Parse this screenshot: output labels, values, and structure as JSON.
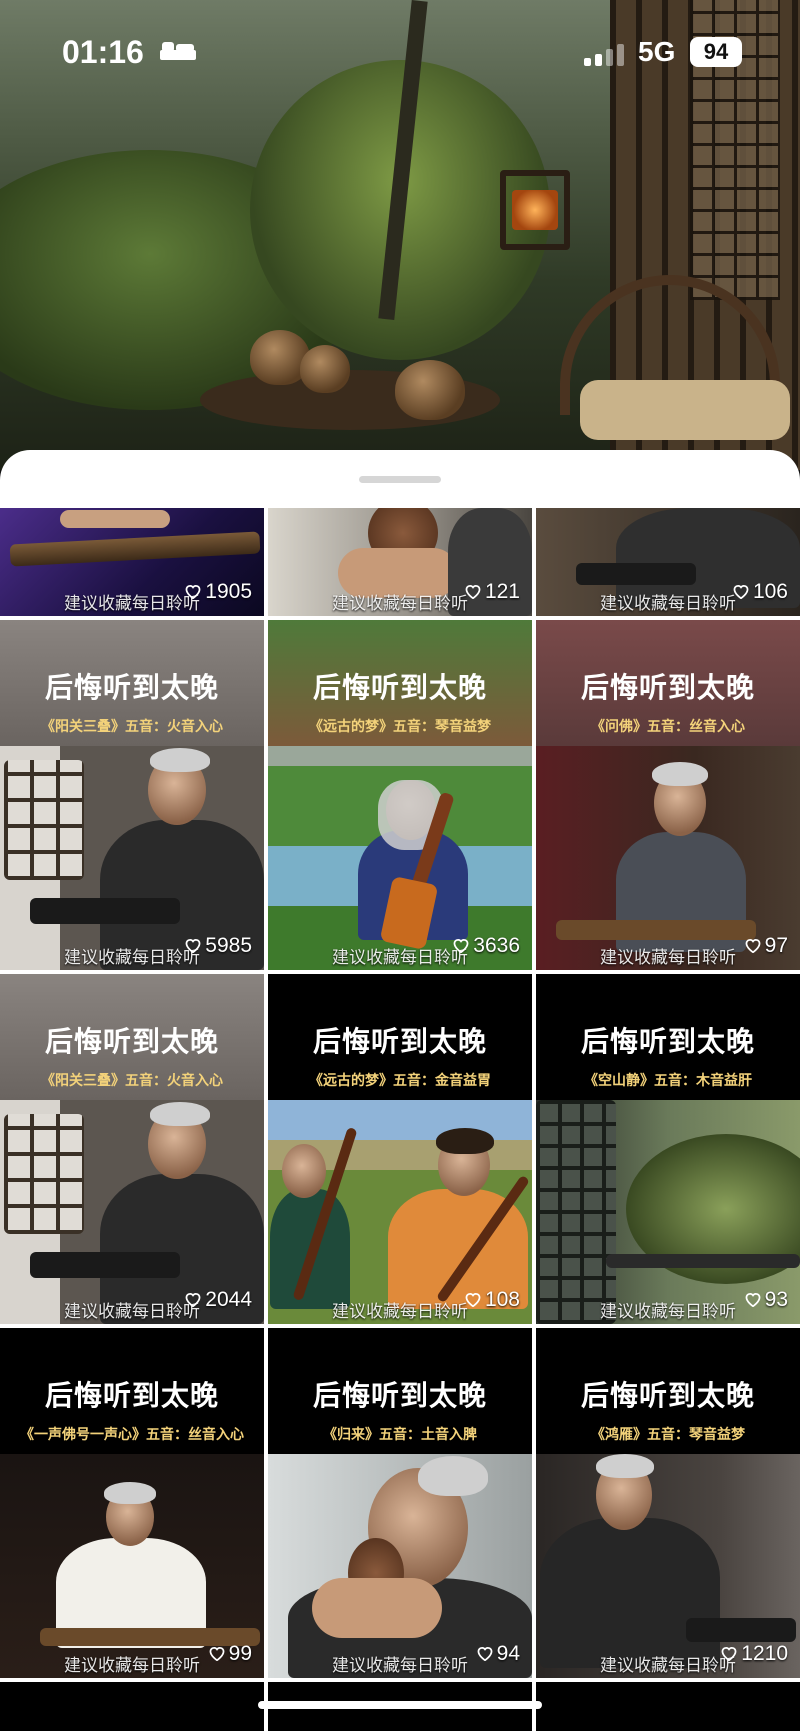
{
  "status_bar": {
    "time": "01:16",
    "network": "5G",
    "battery": "94"
  },
  "feed": {
    "caption": "建议收藏每日聆听",
    "tiles": [
      {
        "title": "",
        "subtitle": "",
        "likes": "1905"
      },
      {
        "title": "",
        "subtitle": "",
        "likes": "121"
      },
      {
        "title": "",
        "subtitle": "",
        "likes": "106"
      },
      {
        "title": "后悔听到太晚",
        "subtitle": "《阳关三叠》五音：火音入心",
        "likes": "5985"
      },
      {
        "title": "后悔听到太晚",
        "subtitle": "《远古的梦》五音：琴音益梦",
        "likes": "3636"
      },
      {
        "title": "后悔听到太晚",
        "subtitle": "《问佛》五音：丝音入心",
        "likes": "97"
      },
      {
        "title": "后悔听到太晚",
        "subtitle": "《阳关三叠》五音：火音入心",
        "likes": "2044"
      },
      {
        "title": "后悔听到太晚",
        "subtitle": "《远古的梦》五音：金音益胃",
        "likes": "108"
      },
      {
        "title": "后悔听到太晚",
        "subtitle": "《空山静》五音：木音益肝",
        "likes": "93"
      },
      {
        "title": "后悔听到太晚",
        "subtitle": "《一声佛号一声心》五音：丝音入心",
        "likes": "99"
      },
      {
        "title": "后悔听到太晚",
        "subtitle": "《归来》五音：土音入脾",
        "likes": "94"
      },
      {
        "title": "后悔听到太晚",
        "subtitle": "《鸿雁》五音：琴音益梦",
        "likes": "1210"
      }
    ]
  },
  "colors": {
    "subtitle": "#f3d27a",
    "sheet": "#ffffff"
  }
}
